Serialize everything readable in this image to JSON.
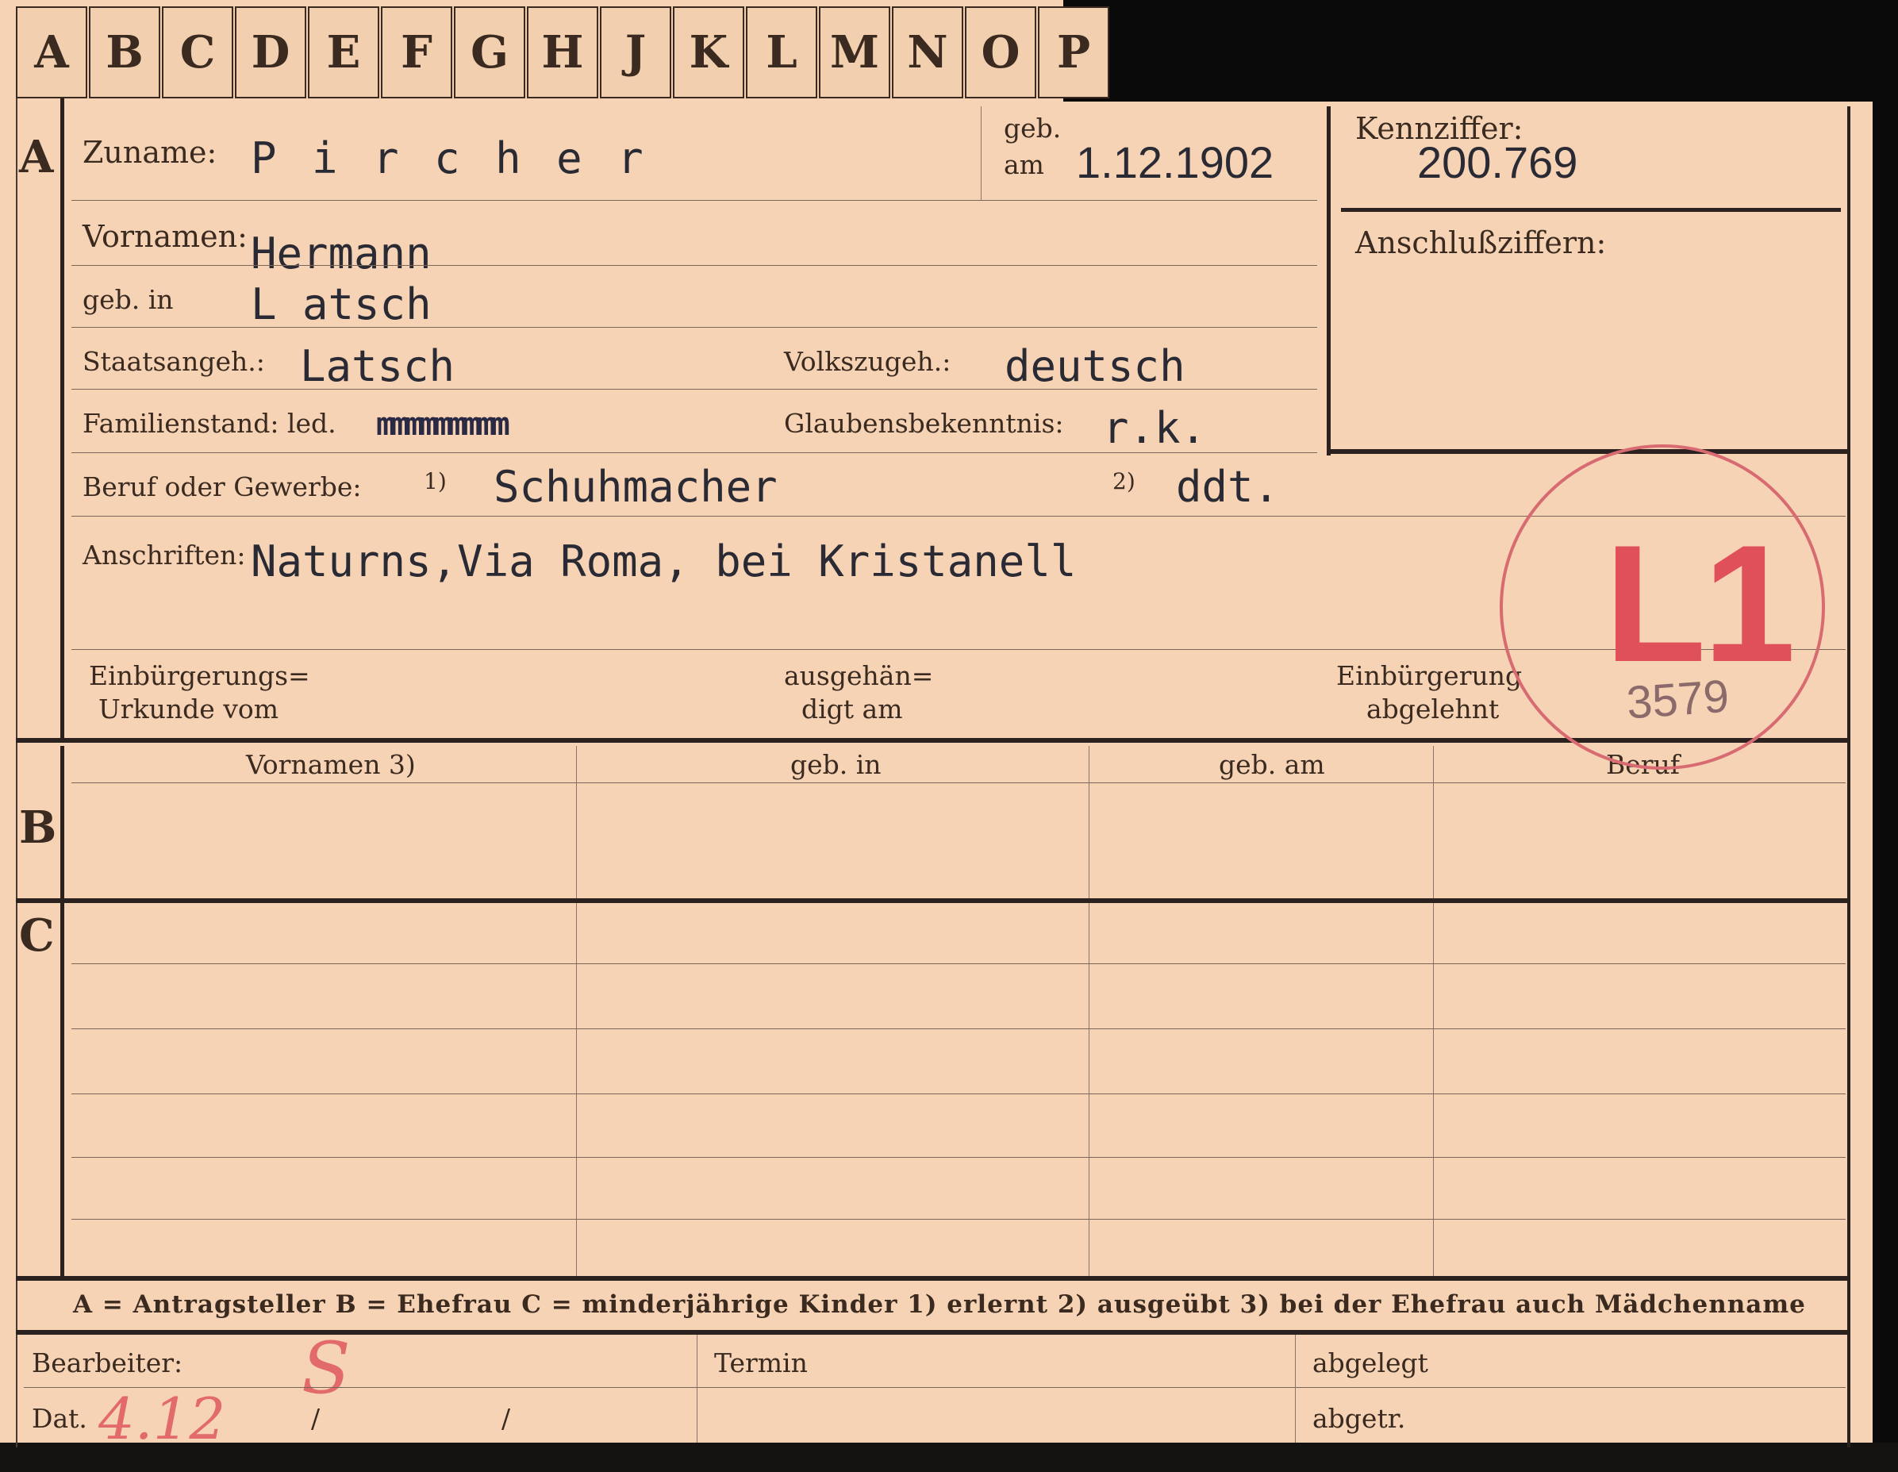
{
  "tabs": [
    "A",
    "B",
    "C",
    "D",
    "E",
    "F",
    "G",
    "H",
    "J",
    "K",
    "L",
    "M",
    "N",
    "O",
    "P"
  ],
  "section_letters": {
    "a": "A",
    "b": "B",
    "c": "C"
  },
  "person": {
    "surname_label": "Zuname:",
    "surname": "P i r c h e r",
    "born_on_label_1": "geb.",
    "born_on_label_2": "am",
    "birth_date": "1.12.1902",
    "given_names_label": "Vornamen:",
    "given_names": "Hermann",
    "born_in_label": "geb. in",
    "birthplace": "L atsch",
    "citizenship_label": "Staatsangeh.:",
    "citizenship": "Latsch",
    "ethnicity_label": "Volkszugeh.:",
    "ethnicity": "deutsch",
    "marital_label": "Familienstand: led.",
    "marital_struck": "mmmmmmmmm",
    "religion_label": "Glaubensbekenntnis:",
    "religion": "r.k.",
    "occupation_label": "Beruf oder Gewerbe:",
    "occ_note1": "1)",
    "occupation_learned": "Schuhmacher",
    "occ_note2": "2)",
    "occupation_practiced": "ddt.",
    "address_label": "Anschriften:",
    "address": "Naturns,Via Roma, bei Kristanell",
    "naturalization_label_1": "Einbürgerungs=",
    "naturalization_label_2": "Urkunde vom",
    "handed_label_1": "ausgehän=",
    "handed_label_2": "digt am",
    "rejected_label_1": "Einbürgerung",
    "rejected_label_2": "abgelehnt"
  },
  "reference": {
    "id_label": "Kennziffer:",
    "id_number": "200.769",
    "linked_label": "Anschlußziffern:"
  },
  "stamp": {
    "text": "L1",
    "number": "3579"
  },
  "section_b": {
    "headers": [
      "Vornamen 3)",
      "geb. in",
      "geb. am",
      "Beruf"
    ]
  },
  "legend": "A = Antragsteller   B = Ehefrau   C = minderjährige Kinder   1) erlernt   2) ausgeübt   3) bei der Ehefrau auch Mädchenname",
  "footer": {
    "processor_label": "Bearbeiter:",
    "processor_initial": "S",
    "date_label": "Dat.",
    "date_hand": "4.12",
    "slash1": "/",
    "slash2": "/",
    "deadline_label": "Termin",
    "filed_label": "abgelegt",
    "removed_label": "abgetr."
  },
  "colors": {
    "paper": "#f6d3b4",
    "ink": "#3a2a20",
    "stamp": "#e0505a"
  }
}
